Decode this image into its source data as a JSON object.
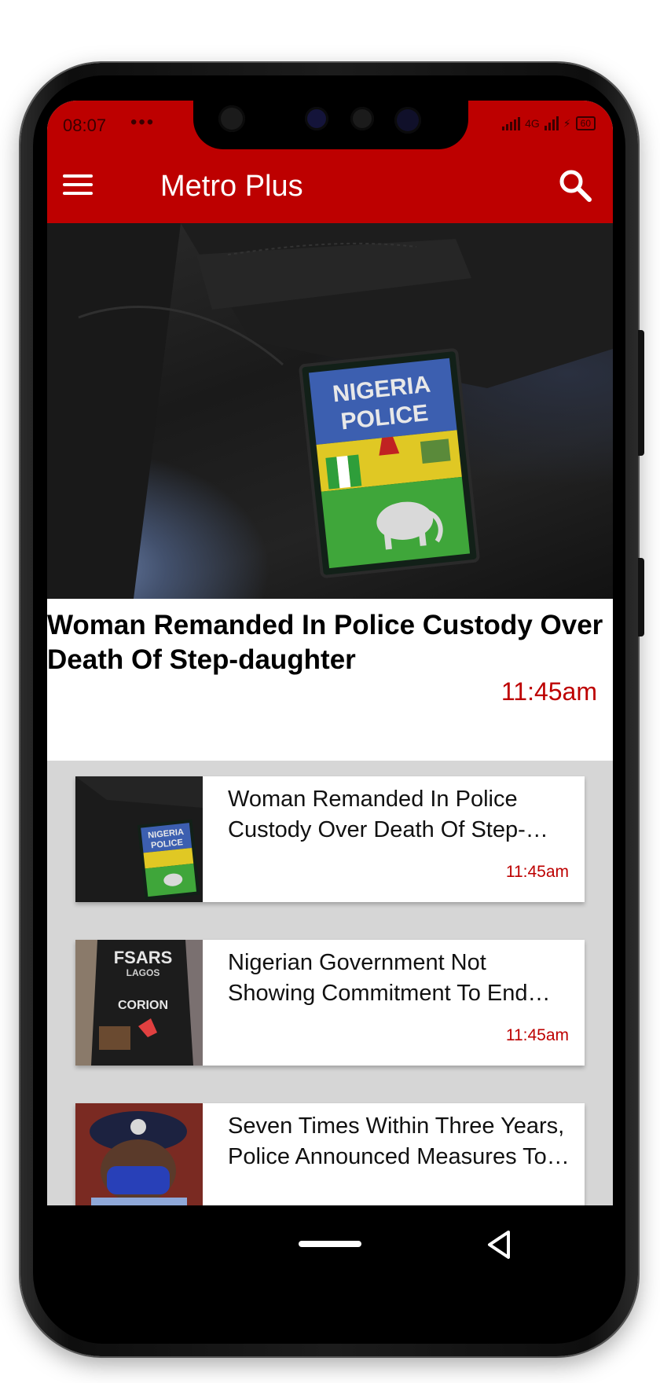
{
  "status_bar": {
    "time": "08:07",
    "dots": "•••",
    "network": "4G",
    "battery": "60"
  },
  "app_bar": {
    "title": "Metro Plus",
    "menu_icon": "hamburger-menu-icon",
    "search_icon": "search-icon"
  },
  "featured": {
    "image": "nigeria-police-patch-photo",
    "patch_text": "NIGERIA POLICE",
    "title": "Woman Remanded In Police Custody Over Death Of Step-daughter",
    "time": "11:45am"
  },
  "articles": [
    {
      "image": "nigeria-police-patch-thumbnail",
      "title": "Woman Remanded In Police Custody Over Death Of Step-daughter",
      "time": "11:45am"
    },
    {
      "image": "fsars-officer-thumbnail",
      "title": "Nigerian Government Not Showing Commitment To End Lawlessness",
      "time": "11:45am"
    },
    {
      "image": "police-officer-mask-thumbnail",
      "title": "Seven Times Within Three Years, Police Announced Measures To Reform",
      "time": ""
    }
  ],
  "colors": {
    "brand_red": "#bd0000",
    "list_background": "#d6d6d6"
  },
  "nav_bar": {
    "home_icon": "home-pill-icon",
    "back_icon": "back-triangle-icon"
  }
}
